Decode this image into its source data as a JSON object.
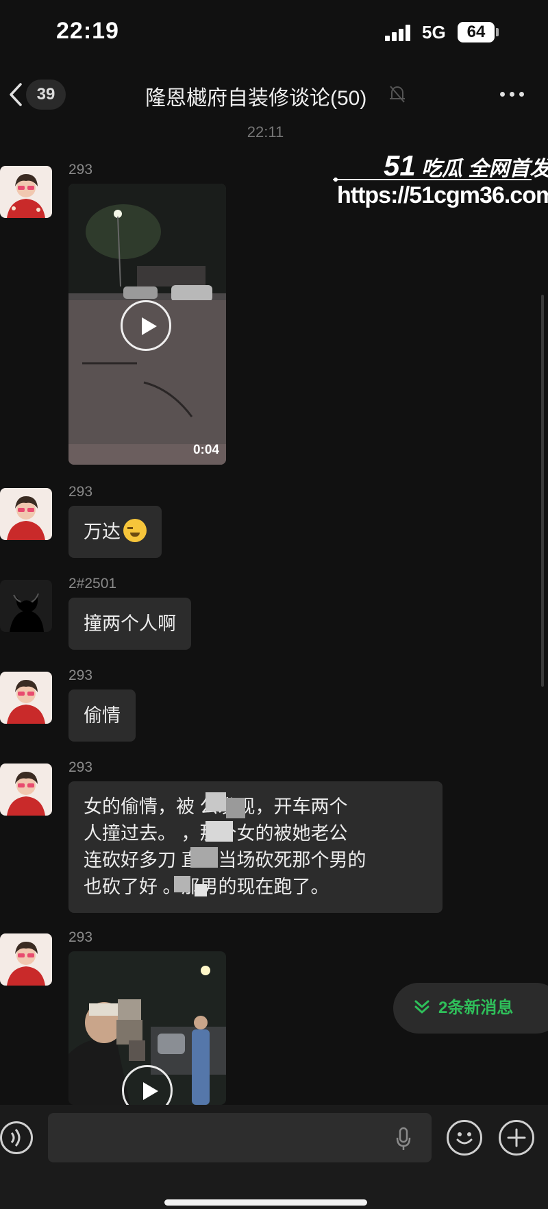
{
  "status_bar": {
    "time": "22:19",
    "network": "5G",
    "battery": "64"
  },
  "header": {
    "back_count": "39",
    "title": "隆恩樾府自装修谈论(50)",
    "icons": [
      "back-chevron-icon",
      "mute-bell-icon",
      "more-dots-icon"
    ]
  },
  "timestamp": "22:11",
  "watermark": {
    "brand_num": "51",
    "brand_text": "吃瓜 全网首发",
    "url": "https://51cgm36.com"
  },
  "messages": [
    {
      "sender": "293",
      "type": "video",
      "duration": "0:04"
    },
    {
      "sender": "293",
      "type": "text",
      "text": "万达"
    },
    {
      "sender": "2#2501",
      "type": "text",
      "text": "撞两个人啊"
    },
    {
      "sender": "293",
      "type": "text",
      "text": "偷情"
    },
    {
      "sender": "293",
      "type": "text",
      "lines": [
        "女的偷情，被    公发现，开车两个",
        "人撞过去。     ，那个女的被她老公",
        "连砍好多刀    直接当场砍死那个男的",
        "也砍了好    。那男的现在跑了。"
      ]
    },
    {
      "sender": "293",
      "type": "video"
    }
  ],
  "new_messages": "2条新消息",
  "input": {
    "value": "",
    "placeholder": ""
  },
  "colors": {
    "background": "#111111",
    "bubble": "#2c2c2c",
    "accent_green": "#2fbf5a"
  }
}
